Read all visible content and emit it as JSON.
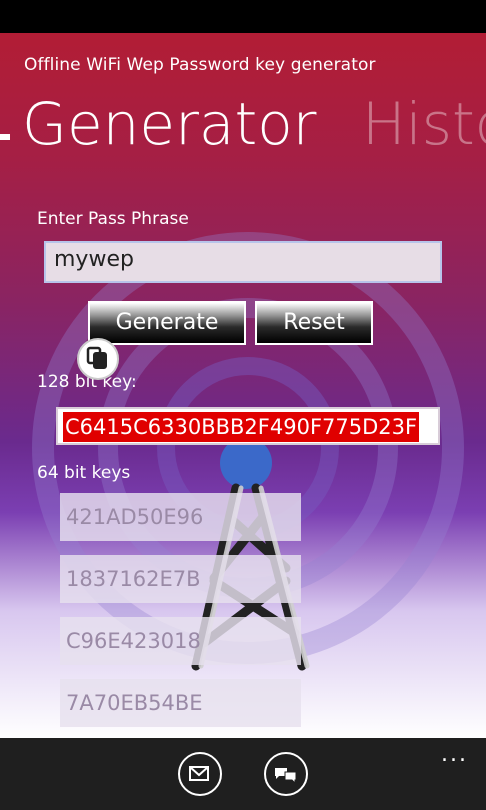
{
  "app": {
    "title": "Offline WiFi Wep Password key generator",
    "pivots": [
      "Generator",
      "History"
    ]
  },
  "form": {
    "pass_phrase_label": "Enter Pass Phrase",
    "pass_phrase_value": "mywep",
    "generate_label": "Generate",
    "reset_label": "Reset"
  },
  "keys": {
    "key128_label": "128 bit key:",
    "key128_value": "C6415C6330BBB2F490F775D23F",
    "key64_label": "64 bit keys",
    "key64_values": [
      "421AD50E96",
      "1837162E7B",
      "C96E423018",
      "7A70EB54BE"
    ]
  },
  "appbar": {
    "buttons": [
      "mail-icon",
      "feedback-icon"
    ],
    "more": "..."
  },
  "colors": {
    "key_highlight": "#e00000",
    "appbar": "#1f1f1f"
  }
}
